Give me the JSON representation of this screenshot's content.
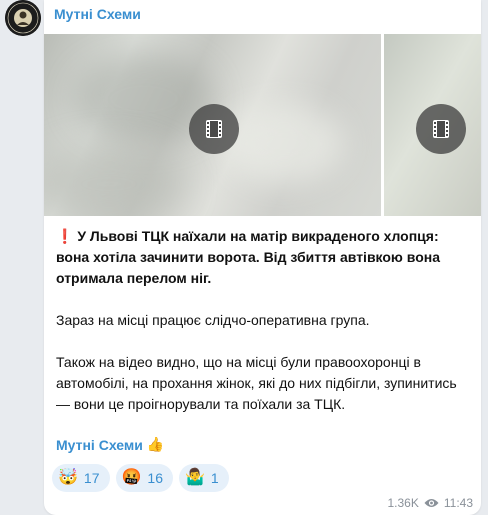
{
  "channel": {
    "name": "Мутні Схеми",
    "avatar_text": "МУТНІ СХЕМИ",
    "avatar_icon": "channel-logo-icon"
  },
  "media": [
    {
      "type": "video",
      "icon": "video-icon"
    },
    {
      "type": "video",
      "icon": "video-icon"
    }
  ],
  "post": {
    "alert_emoji": "❗",
    "headline": " У Львові ТЦК наїхали на матір викраденого хлопця: вона хотіла зачинити ворота. Від збиття автівкою вона отримала перелом ніг.",
    "paragraph2": "Зараз на місці працює слідчо-оперативна група.",
    "paragraph3": "Також на відео видно, що на місці були правоохоронці в автомобілі, на прохання жінок, які до них підбігли, зупинитись — вони це проігнорували та поїхали за ТЦК."
  },
  "signature": {
    "label": "Мутні Схеми",
    "emoji": "👍"
  },
  "reactions": [
    {
      "emoji": "🤯",
      "count": "17"
    },
    {
      "emoji": "🤬",
      "count": "16"
    },
    {
      "emoji": "🤷‍♂️",
      "count": "1"
    }
  ],
  "meta": {
    "views": "1.36K",
    "time": "11:43",
    "icon": "eye-icon"
  },
  "colors": {
    "accent": "#3a8fd0",
    "background": "#e8ebef",
    "bubble": "#ffffff",
    "meta_text": "#8a9199"
  }
}
